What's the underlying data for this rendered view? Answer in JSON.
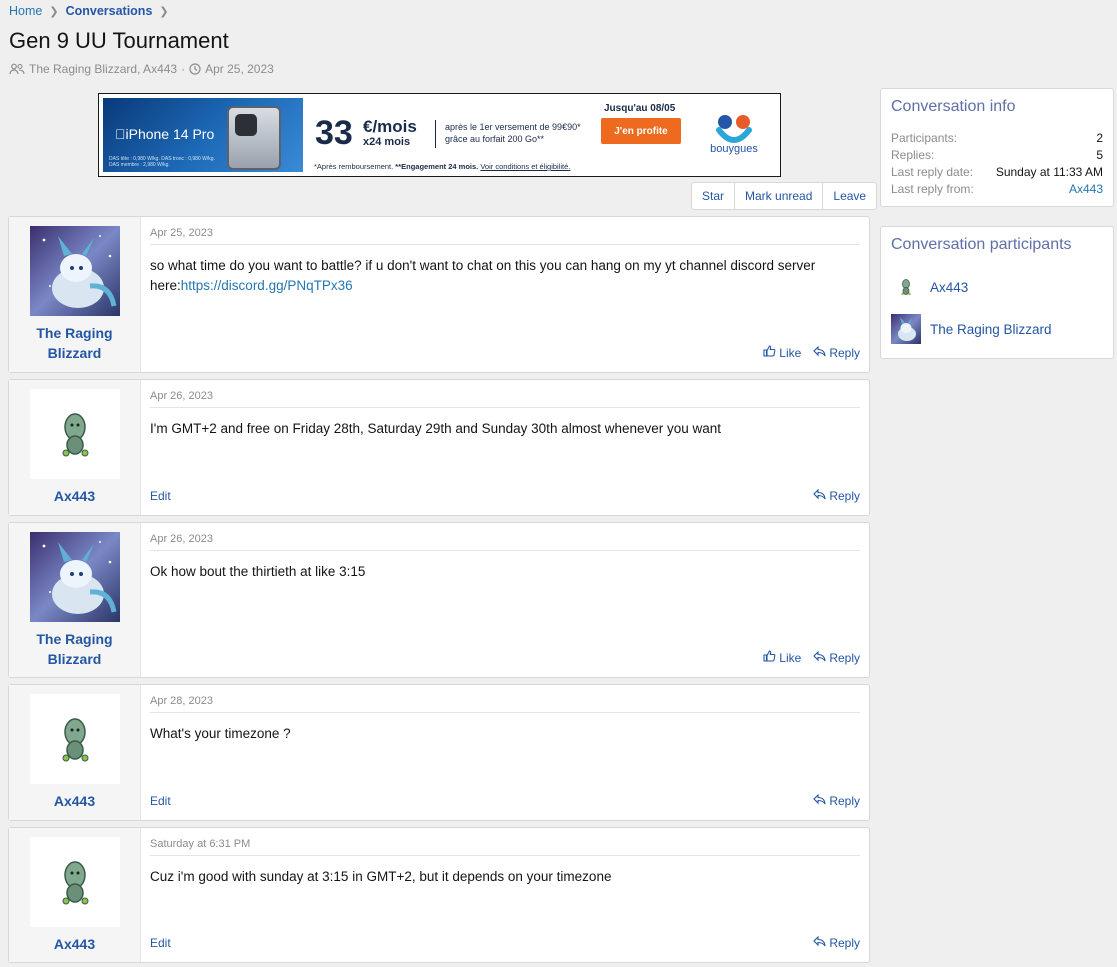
{
  "breadcrumb": {
    "home": "Home",
    "conversations": "Conversations"
  },
  "page": {
    "title": "Gen 9 UU Tournament",
    "participants_line": "The Raging Blizzard, Ax443",
    "meta_sep": "·",
    "date": "Apr 25, 2023"
  },
  "ad": {
    "brand": "iPhone 14 Pro",
    "fine_print": "DAS tête : 0,980 W/kg. DAS tronc : 0,980 W/kg. DAS membre : 2,980 W/kg.",
    "price": "33",
    "price_unit": "€/mois",
    "price_duration": "x24 mois",
    "info_line1": "après le 1er versement de 99€90*",
    "info_line2": "grâce au forfait 200 Go**",
    "until": "Jusqu'au 08/05",
    "cta": "J'en profite",
    "footnote_a": "*Après remboursement.",
    "footnote_b": "**Engagement 24 mois.",
    "footnote_c": "Voir conditions et éligibilité.",
    "logo_text": "bouygues",
    "colors": {
      "cta": "#ee6a1f",
      "navy": "#1a2b4a"
    }
  },
  "toolbar": {
    "star": "Star",
    "mark_unread": "Mark unread",
    "leave": "Leave"
  },
  "messages": [
    {
      "author": "The Raging Blizzard",
      "date": "Apr 25, 2023",
      "text": "so what time do you want to battle? if u don't want to chat on this you can hang on my yt channel discord server here:",
      "link": "https://discord.gg/PNqTPx36",
      "like": "Like",
      "reply": "Reply"
    },
    {
      "author": "Ax443",
      "date": "Apr 26, 2023",
      "text": "I'm GMT+2 and free on Friday 28th, Saturday 29th and Sunday 30th almost whenever you want",
      "edit": "Edit",
      "reply": "Reply"
    },
    {
      "author": "The Raging Blizzard",
      "date": "Apr 26, 2023",
      "text": "Ok how bout the thirtieth at like 3:15",
      "like": "Like",
      "reply": "Reply"
    },
    {
      "author": "Ax443",
      "date": "Apr 28, 2023",
      "text": "What's your timezone ?",
      "edit": "Edit",
      "reply": "Reply"
    },
    {
      "author": "Ax443",
      "date": "Saturday at 6:31 PM",
      "text": "Cuz i'm good with sunday at 3:15 in GMT+2, but it depends on your timezone",
      "edit": "Edit",
      "reply": "Reply"
    }
  ],
  "sidebar": {
    "info_title": "Conversation info",
    "info": [
      {
        "key": "Participants:",
        "value": "2"
      },
      {
        "key": "Replies:",
        "value": "5"
      },
      {
        "key": "Last reply date:",
        "value": "Sunday at 11:33 AM"
      },
      {
        "key": "Last reply from:",
        "value": "Ax443"
      }
    ],
    "participants_title": "Conversation participants",
    "participants": [
      "Ax443",
      "The Raging Blizzard"
    ]
  }
}
